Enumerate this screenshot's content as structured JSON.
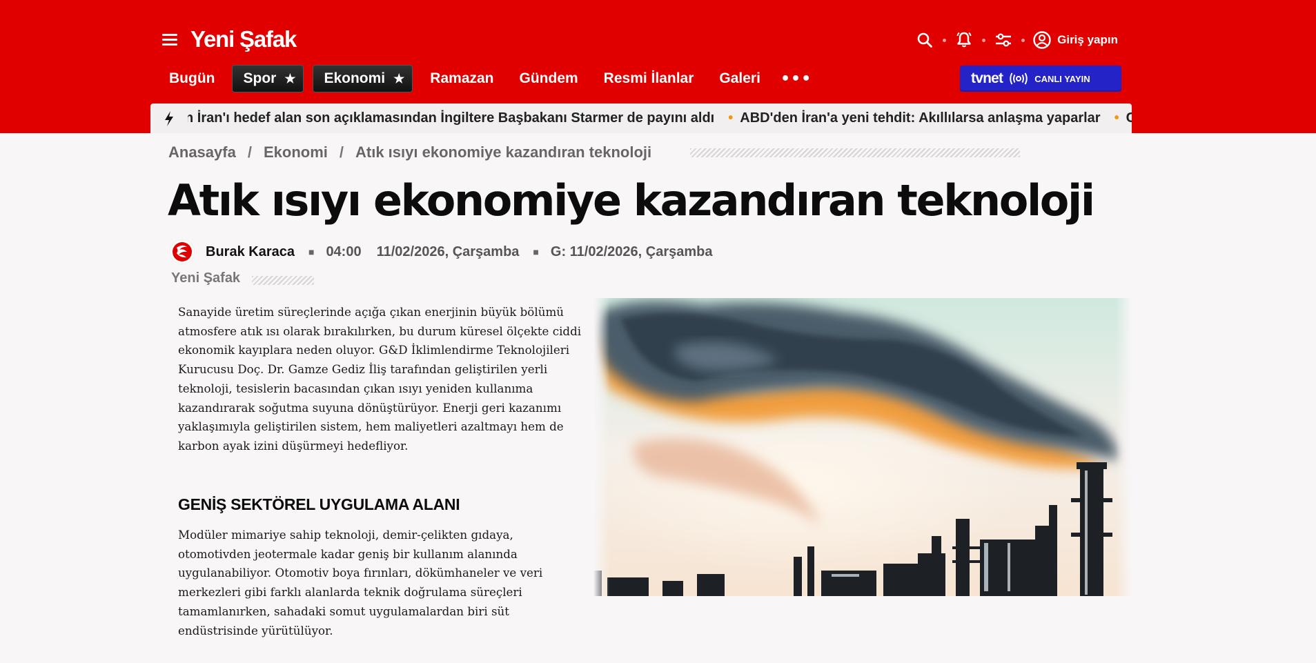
{
  "header": {
    "logo": "Yeni Şafak",
    "login_label": "Giriş yapın"
  },
  "nav": {
    "items": [
      "Bugün",
      "Spor",
      "Ekonomi",
      "Ramazan",
      "Gündem",
      "Resmi İlanlar",
      "Galeri"
    ],
    "starred": [
      "Spor",
      "Ekonomi"
    ],
    "more": "•••",
    "live": {
      "brand": "tvnet",
      "label": "CANLI YAYIN"
    }
  },
  "ticker": {
    "items": [
      "n İran'ı hedef alan son açıklamasından İngiltere Başbakanı Starmer de payını aldı",
      "ABD'den İran'a yeni tehdit: Akıllılarsa anlaşma yaparlar",
      "Cu"
    ]
  },
  "breadcrumb": [
    "Anasayfa",
    "Ekonomi",
    "Atık ısıyı ekonomiye kazandıran teknoloji"
  ],
  "article": {
    "title": "Atık ısıyı ekonomiye kazandıran teknoloji",
    "author": "Burak Karaca",
    "time": "04:00",
    "date": "11/02/2026, Çarşamba",
    "updated": "G: 11/02/2026, Çarşamba",
    "source": "Yeni Şafak",
    "paragraph1": "Sanayide üretim süreçlerinde açığa çıkan enerjinin büyük bölümü atmosfere atık ısı olarak bırakılırken, bu durum küresel ölçekte ciddi ekonomik kayıplara neden oluyor. G&D İklimlendirme Teknolojileri Kurucusu Doç. Dr. Gamze Gediz İliş tarafından geliştirilen yerli teknoloji, tesislerin bacasından çıkan ısıyı yeniden kullanıma kazandırarak soğutma suyuna dönüştürüyor. Enerji geri kazanımı yaklaşımıyla geliştirilen sistem, hem maliyetleri azaltmayı hem de karbon ayak izini düşürmeyi hedefliyor.",
    "section_heading": "GENİŞ SEKTÖREL UYGULAMA ALANI",
    "paragraph2": "Modüler mimariye sahip teknoloji, demir-çelikten gıdaya, otomotivden jeotermale kadar geniş bir kullanım alanında uygulanabiliyor. Otomotiv boya fırınları, dökümhaneler ve veri merkezleri gibi farklı alanlarda teknik doğrulama süreçleri tamamlanırken, sahadaki somut uygulamalardan biri süt endüstrisinde yürütülüyor."
  },
  "colors": {
    "brand_red": "#e10000",
    "live_blue": "#2323c8",
    "ticker_dot": "#f2960b"
  },
  "icons": [
    "menu-icon",
    "search-icon",
    "bell-icon",
    "filter-icon",
    "user-circle-icon",
    "bolt-icon",
    "broadcast-icon",
    "star-icon"
  ]
}
